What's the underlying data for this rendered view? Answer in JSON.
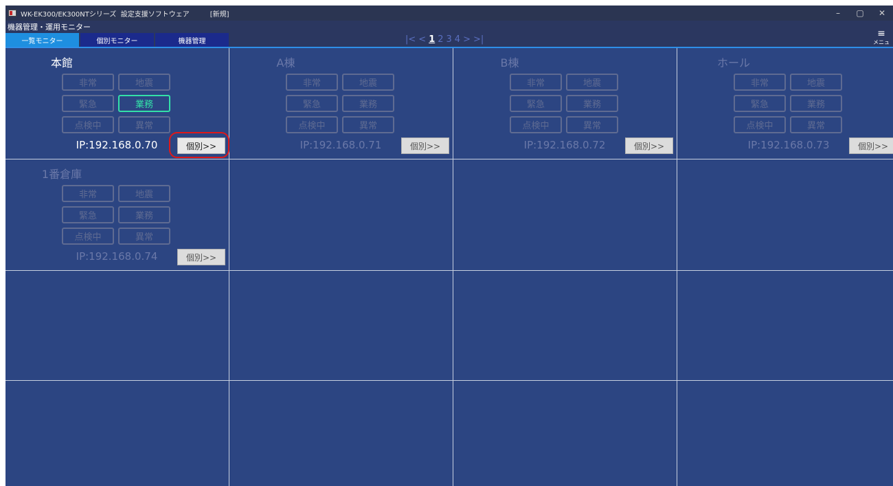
{
  "titlebar": {
    "title": "WK-EK300/EK300NTシリーズ  設定支援ソフトウェア",
    "doc": "[新規]",
    "minimize": "–",
    "restore": "▢",
    "close": "✕"
  },
  "header": {
    "title": "機器管理・運用モニター",
    "tabs": [
      {
        "label": "一覧モニター",
        "active": true
      },
      {
        "label": "個別モニター",
        "active": false
      },
      {
        "label": "機器管理",
        "active": false
      }
    ],
    "pager": {
      "first": "|<",
      "prev": "<",
      "pages": [
        "1",
        "2",
        "3",
        "4"
      ],
      "next": ">",
      "last": ">|",
      "current": "1"
    },
    "menu": {
      "icon": "menu-icon",
      "label": "メニュー"
    }
  },
  "devices": [
    {
      "name": "本館",
      "ip": "IP:192.168.0.70",
      "detail": "個別>>",
      "active": true,
      "statuses": [
        "非常",
        "地震",
        "緊急",
        "業務",
        "点検中",
        "異常"
      ],
      "on_index": 3
    },
    {
      "name": "A棟",
      "ip": "IP:192.168.0.71",
      "detail": "個別>>",
      "active": false,
      "statuses": [
        "非常",
        "地震",
        "緊急",
        "業務",
        "点検中",
        "異常"
      ]
    },
    {
      "name": "B棟",
      "ip": "IP:192.168.0.72",
      "detail": "個別>>",
      "active": false,
      "statuses": [
        "非常",
        "地震",
        "緊急",
        "業務",
        "点検中",
        "異常"
      ]
    },
    {
      "name": "ホール",
      "ip": "IP:192.168.0.73",
      "detail": "個別>>",
      "active": false,
      "statuses": [
        "非常",
        "地震",
        "緊急",
        "業務",
        "点検中",
        "異常"
      ]
    },
    {
      "name": "1番倉庫",
      "ip": "IP:192.168.0.74",
      "detail": "個別>>",
      "active": false,
      "statuses": [
        "非常",
        "地震",
        "緊急",
        "業務",
        "点検中",
        "異常"
      ]
    }
  ],
  "colors": {
    "accent": "#1e8fe0",
    "status_on": "#34e0a8",
    "highlight": "#e01818",
    "panel": "#2c4582"
  }
}
